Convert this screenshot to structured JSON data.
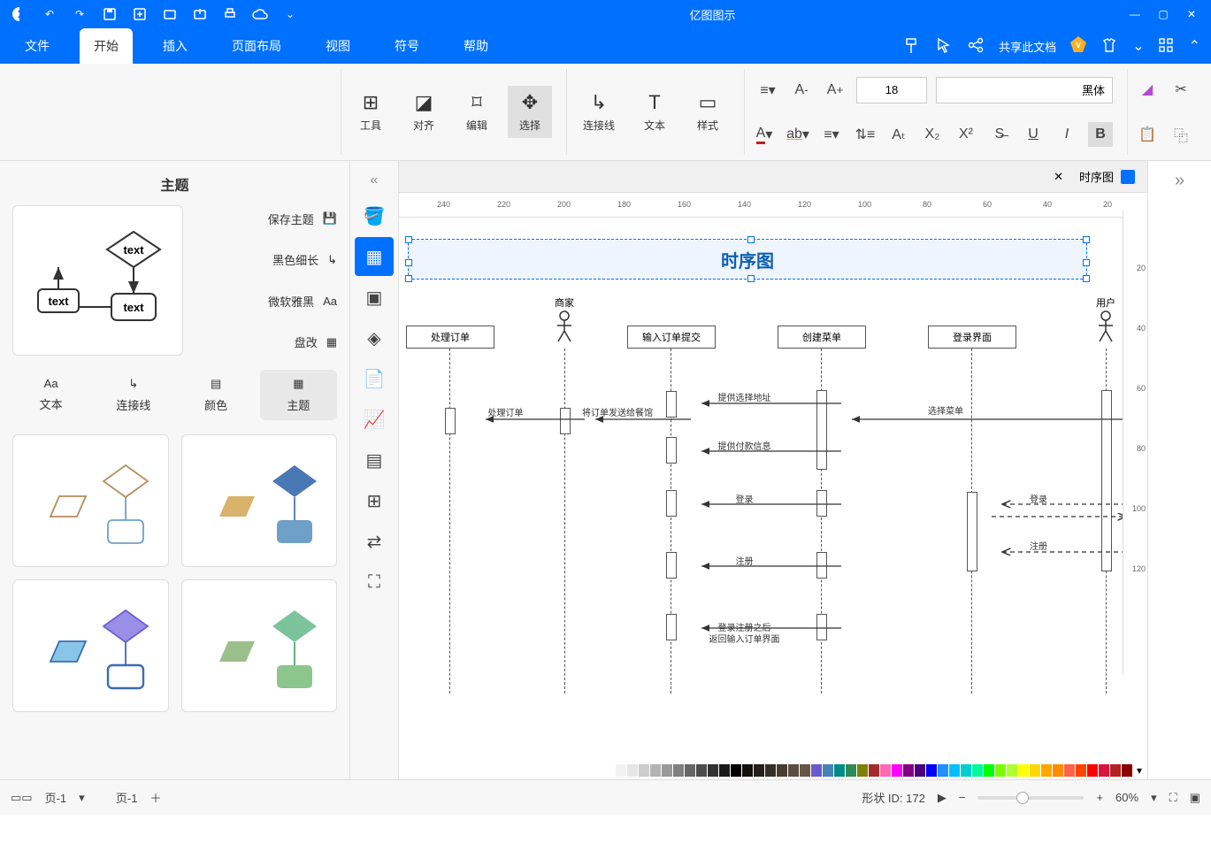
{
  "titlebar": {
    "title": "亿图图示"
  },
  "menu": {
    "file": "文件",
    "start": "开始",
    "insert": "插入",
    "page_layout": "页面布局",
    "view": "视图",
    "symbol": "符号",
    "help": "帮助",
    "cloud_doc": "共享此文档"
  },
  "ribbon": {
    "font_name": "黑体",
    "font_size": "18",
    "style": "样式",
    "text": "文本",
    "connector": "连接线",
    "edit": "编辑",
    "select": "选择",
    "align": "对齐",
    "tools": "工具"
  },
  "doc_tab": {
    "name": "时序图"
  },
  "canvas_title": "时序图",
  "lanes": {
    "user": "用户",
    "login_ui": "登录界面",
    "create_menu": "创建菜单",
    "submit_order": "输入订单提交",
    "merchant": "商家",
    "process_order": "处理订单"
  },
  "arrows": {
    "a1": "选择菜单",
    "a2": "提供选择地址",
    "a3": "将订单发送给餐馆",
    "a4": "处理订单",
    "a5": "提供付款信息",
    "a6": "登录",
    "a7": "登录",
    "a8": "注册",
    "a9": "注册",
    "a10a": "登录注册之后",
    "a10b": "返回输入订单界面"
  },
  "theme": {
    "title": "主题",
    "save": "保存主题",
    "black_line": "黑色细长",
    "msyh": "微软雅黑",
    "bold": "盘改",
    "tab_theme": "主题",
    "tab_color": "颜色",
    "tab_connector": "连接线",
    "tab_text": "文本"
  },
  "status": {
    "page_right": "页-1",
    "page_left": "页-1",
    "shape_id": "形状 ID: 172",
    "zoom": "60%"
  },
  "ruler_ticks_h": [
    "20",
    "40",
    "60",
    "80",
    "100",
    "120",
    "140",
    "160",
    "180",
    "200",
    "220",
    "240"
  ],
  "ruler_ticks_v": [
    "20",
    "40",
    "60",
    "80",
    "100",
    "120"
  ],
  "chart_data": {
    "type": "sequence-diagram",
    "title": "时序图",
    "participants": [
      "用户",
      "登录界面",
      "创建菜单",
      "输入订单提交",
      "商家",
      "处理订单"
    ],
    "messages": [
      {
        "from": "用户",
        "to": "创建菜单",
        "label": "选择菜单"
      },
      {
        "from": "创建菜单",
        "to": "输入订单提交",
        "label": "提供选择地址"
      },
      {
        "from": "输入订单提交",
        "to": "商家",
        "label": "将订单发送给餐馆"
      },
      {
        "from": "商家",
        "to": "处理订单",
        "label": "处理订单"
      },
      {
        "from": "创建菜单",
        "to": "输入订单提交",
        "label": "提供付款信息"
      },
      {
        "from": "用户",
        "to": "登录界面",
        "label": "登录",
        "dashed": true,
        "return": true
      },
      {
        "from": "创建菜单",
        "to": "输入订单提交",
        "label": "登录"
      },
      {
        "from": "用户",
        "to": "登录界面",
        "label": "注册",
        "dashed": true,
        "return": true
      },
      {
        "from": "创建菜单",
        "to": "输入订单提交",
        "label": "注册"
      },
      {
        "from": "创建菜单",
        "to": "输入订单提交",
        "label": "登录注册之后 返回输入订单界面"
      }
    ]
  },
  "color_palette": [
    "#8b0000",
    "#b22222",
    "#dc143c",
    "#ff0000",
    "#ff4500",
    "#ff6347",
    "#ff8c00",
    "#ffa500",
    "#ffd700",
    "#ffff00",
    "#adff2f",
    "#7cfc00",
    "#00ff00",
    "#00fa9a",
    "#00ced1",
    "#00bfff",
    "#1e90ff",
    "#0000ff",
    "#4b0082",
    "#800080",
    "#ff00ff",
    "#ff69b4",
    "#a52a2a",
    "#808000",
    "#2e8b57",
    "#008b8b",
    "#4682b4",
    "#6a5acd",
    "#695547",
    "#5a4c3f",
    "#483c32",
    "#362e26",
    "#241f19",
    "#12100d",
    "#000000",
    "#1a1a1a",
    "#333333",
    "#4d4d4d",
    "#666666",
    "#808080",
    "#999999",
    "#b3b3b3",
    "#cccccc",
    "#e6e6e6",
    "#f2f2f2",
    "#ffffff"
  ]
}
